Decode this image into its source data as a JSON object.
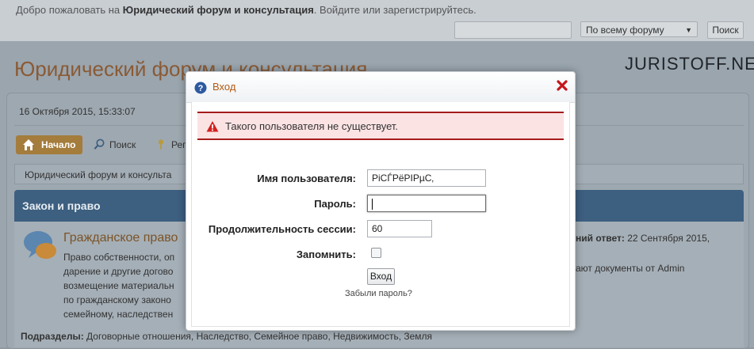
{
  "topbar": {
    "welcome_prefix": "Добро пожаловать на ",
    "welcome_forum": "Юридический форум и консультация",
    "welcome_suffix": ". Войдите или зарегистрируйтесь.",
    "search_value": "",
    "scope_selected": "По всему форуму",
    "search_button": "Поиск"
  },
  "header": {
    "site_title": "Юридический форум и консультация",
    "brand": "JURISTOFF.NET"
  },
  "infobar": {
    "datetime": "16 Октября 2015, 15:33:07"
  },
  "nav": {
    "home": "Начало",
    "search": "Поиск",
    "register": "Рег"
  },
  "breadcrumb": "Юридический форум и консульта",
  "category": {
    "title": "Закон и право"
  },
  "board": {
    "title": "Гражданское право",
    "desc_lines": [
      "Право собственности, оп",
      "дарение и другие догово",
      "возмещение материальн",
      "по гражданскому законо",
      "семейному, наследствен"
    ],
    "last_post_label": "ний ответ:",
    "last_post_date": " 22 Сентября 2015,",
    "last_post_line2": "ают документы от Admin",
    "subboards_label": "Подразделы:",
    "subboards_list": " Договорные отношения, Наследство, Семейное право, Недвижимость, Земля"
  },
  "modal": {
    "title": "Вход",
    "error": "Такого пользователя не существует.",
    "username_label": "Имя пользователя:",
    "username_value": "РiСЃРёРІРµС‚",
    "password_label": "Пароль:",
    "password_value": "",
    "session_label": "Продолжительность сессии:",
    "session_value": "60",
    "remember_label": "Запомнить:",
    "submit": "Вход",
    "forgot": "Забыли пароль?"
  },
  "colors": {
    "accent_orange": "#b35a12",
    "error_border": "#a51c1c",
    "error_bg": "#fbe3e4",
    "category_bar": "#3d5f80",
    "home_button": "#a47c3c"
  }
}
